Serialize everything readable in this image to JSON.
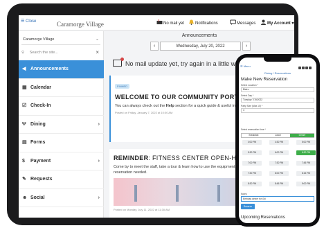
{
  "topbar": {
    "close_label": "☰ Close",
    "logo_text": "Caramorge Village",
    "no_mail_label": "No mail yet",
    "notifications_label": "Notifications",
    "messages_label": "Messages",
    "account_label": "My Account ▾"
  },
  "sidebar": {
    "community_select": "Caramorge Village",
    "search_placeholder": "Search the site...",
    "items": [
      {
        "label": "Announcements",
        "icon": "megaphone-icon",
        "active": true
      },
      {
        "label": "Calendar",
        "icon": "calendar-icon"
      },
      {
        "label": "Check-In",
        "icon": "checkbox-icon"
      },
      {
        "label": "Dining",
        "icon": "utensils-icon",
        "chevron": "›"
      },
      {
        "label": "Forms",
        "icon": "document-icon"
      },
      {
        "label": "Payment",
        "icon": "dollar-icon",
        "chevron": "›"
      },
      {
        "label": "Requests",
        "icon": "wrench-icon"
      },
      {
        "label": "Social",
        "icon": "people-icon",
        "chevron": "›"
      }
    ]
  },
  "main": {
    "title": "Announcements",
    "date": "Wednesday, July 20, 2022",
    "prev": "‹",
    "next": "›",
    "mail_message": "No mail update yet, try again in a little while.",
    "posts": [
      {
        "badge": "PINNED",
        "title": "WELCOME TO OUR COMMUNITY PORTAL",
        "body_pre": "You can always check out the ",
        "body_bold": "Help",
        "body_post": " section for a quick guide & useful info to help you navigate this tool.",
        "meta": "Posted on Friday, January 7, 2022 at 10:00 AM"
      },
      {
        "title_bold": "REMINDER",
        "title_rest": ": FITNESS CENTER OPEN-HOUSE",
        "body": "Come by to meet the staff, take a tour & learn how to use the equipment correctly. Masks required. No reservation needed.",
        "meta": "Posted on Monday, July 11, 2022 at 11:30 AM"
      }
    ]
  },
  "phone": {
    "menu_label": "☰ Menu",
    "breadcrumb": "Dining / Reservations",
    "heading": "Make New Reservation",
    "location_label": "Select Location *",
    "location_value": "Bistro",
    "day_label": "Select Day *",
    "day_value": "Tuesday 7/19/2022",
    "party_label": "Party Size (Max 10) *",
    "party_value": "4",
    "time_label": "Select reservation time *",
    "tabs": [
      "Breakfast",
      "Lunch",
      "Dinner"
    ],
    "active_tab": 2,
    "slots": [
      "4:00 PM",
      "4:30 PM",
      "5:00 PM",
      "5:30 PM",
      "6:00 PM",
      "6:30 PM",
      "7:00 PM",
      "7:30 PM",
      "7:45 PM",
      "7:30 PM",
      "8:00 PM",
      "8:15 PM",
      "8:30 PM",
      "8:45 PM",
      "9:00 PM"
    ],
    "selected_slot": 5,
    "notes_label": "Notes",
    "notes_value": "Birthday dinner for Gill",
    "reserve_label": "Reserve",
    "upcoming_heading": "Upcoming Reservations"
  },
  "colors": {
    "accent": "#3a90d9",
    "selected_green": "#3eae4a",
    "alert_red": "#d64545"
  }
}
